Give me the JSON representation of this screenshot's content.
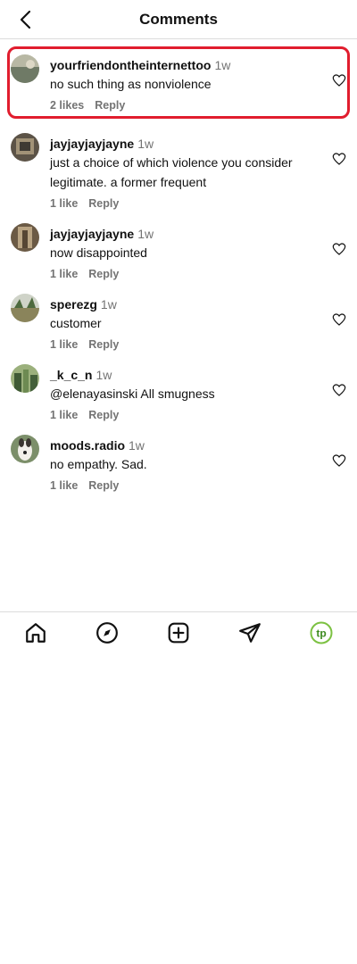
{
  "header": {
    "title": "Comments"
  },
  "comments": [
    {
      "username": "yourfriendontheinternettoo",
      "time": "1w",
      "text": "no such thing as nonviolence",
      "likes": "2 likes",
      "reply": "Reply",
      "avatar_color": "#8f9a86"
    },
    {
      "username": "jayjayjayjayne",
      "time": "1w",
      "text": "just a choice of which violence you consider legitimate. a former frequent",
      "likes": "1 like",
      "reply": "Reply",
      "avatar_color": "#7b6a55"
    },
    {
      "username": "jayjayjayjayne",
      "time": "1w",
      "text": "now disappointed",
      "likes": "1 like",
      "reply": "Reply",
      "avatar_color": "#7b6a55"
    },
    {
      "username": "sperezg",
      "time": "1w",
      "text": "customer",
      "likes": "1 like",
      "reply": "Reply",
      "avatar_color": "#a7a17c"
    },
    {
      "username": "_k_c_n",
      "time": "1w",
      "text": "@elenayasinski All smugness",
      "likes": "1 like",
      "reply": "Reply",
      "avatar_color": "#6e8f5c"
    },
    {
      "username": "moods.radio",
      "time": "1w",
      "text": "no empathy. Sad.",
      "likes": "1 like",
      "reply": "Reply",
      "avatar_color": "#c8c3ba"
    }
  ],
  "nav": {
    "profile_initials": "tp",
    "profile_color": "#7cc142"
  }
}
